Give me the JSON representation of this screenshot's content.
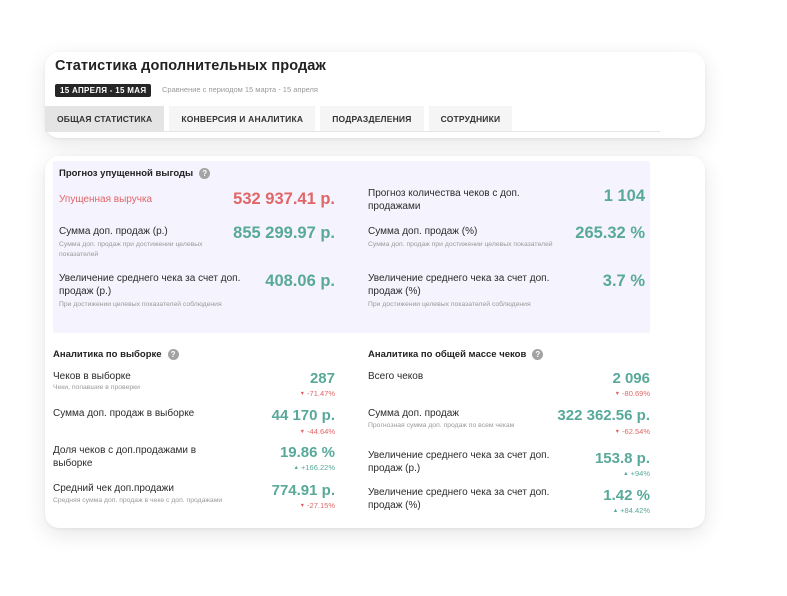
{
  "header": {
    "title": "Статистика дополнительных продаж",
    "period_badge": "15 АПРЕЛЯ - 15 МАЯ",
    "comparison": "Сравнение с периодом 15 марта - 15 апреля"
  },
  "tabs": [
    {
      "label": "ОБЩАЯ СТАТИСТИКА"
    },
    {
      "label": "КОНВЕРСИЯ И АНАЛИТИКА"
    },
    {
      "label": "ПОДРАЗДЕЛЕНИЯ"
    },
    {
      "label": "СОТРУДНИКИ"
    }
  ],
  "forecast": {
    "title": "Прогноз упущенной выгоды",
    "help_icon": "?",
    "lost_revenue_label": "Упущенная выручка",
    "lost_revenue_value": "532 937.41 р.",
    "receipts_forecast_label": "Прогноз количества чеков с доп. продажами",
    "receipts_forecast_value": "1 104",
    "addon_sum_label": "Сумма доп. продаж (р.)",
    "addon_sum_sub": "Сумма доп. продаж при достижении целевых показателей",
    "addon_sum_value": "855 299.97 р.",
    "addon_pct_label": "Сумма доп. продаж (%)",
    "addon_pct_sub": "Сумма доп. продаж при достижении целевых показателей",
    "addon_pct_value": "265.32 %",
    "avg_increase_rub_label": "Увеличение среднего чека за счет доп. продаж (р.)",
    "avg_increase_rub_sub": "При достижении целевых показателей соблюдения",
    "avg_increase_rub_value": "408.06 р.",
    "avg_increase_pct_label": "Увеличение среднего чека за счет доп. продаж (%)",
    "avg_increase_pct_sub": "При достижении целевых показателей соблюдения",
    "avg_increase_pct_value": "3.7 %"
  },
  "sample": {
    "title": "Аналитика по выборке",
    "help_icon": "?",
    "rows": [
      {
        "label": "Чеков в выборке",
        "sub": "Чеки, попавшие в проверки",
        "value": "287",
        "change": "-71.47%",
        "trend": "down"
      },
      {
        "label": "Сумма доп. продаж в выборке",
        "sub": "",
        "value": "44 170 р.",
        "change": "-44.64%",
        "trend": "down"
      },
      {
        "label": "Доля чеков с доп.продажами в выборке",
        "sub": "",
        "value": "19.86 %",
        "change": "+166.22%",
        "trend": "up"
      },
      {
        "label": "Средний чек доп.продажи",
        "sub": "Средняя сумма доп. продаж в чеке с доп. продажами",
        "value": "774.91 р.",
        "change": "-27.15%",
        "trend": "down"
      }
    ]
  },
  "total": {
    "title": "Аналитика по общей массе чеков",
    "help_icon": "?",
    "rows": [
      {
        "label": "Всего чеков",
        "sub": "",
        "value": "2 096",
        "change": "-80.69%",
        "trend": "down"
      },
      {
        "label": "Сумма доп. продаж",
        "sub": "Прогнозная сумма доп. продаж по всем чекам",
        "value": "322 362.56 р.",
        "change": "-62.54%",
        "trend": "down"
      },
      {
        "label": "Увеличение среднего чека за счет доп. продаж (р.)",
        "sub": "",
        "value": "153.8 р.",
        "change": "+94%",
        "trend": "up"
      },
      {
        "label": "Увеличение среднего чека за счет доп. продаж (%)",
        "sub": "",
        "value": "1.42 %",
        "change": "+84.42%",
        "trend": "up"
      }
    ]
  },
  "icons": {
    "arrow_down": "▼",
    "arrow_up": "▲"
  },
  "colors": {
    "positive": "#58a99a",
    "negative": "#e06668",
    "forecast_bg": "#f5f3fd",
    "badge_bg": "#262626"
  }
}
